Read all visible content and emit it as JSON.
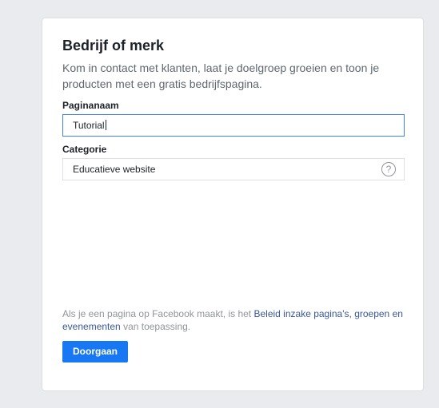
{
  "card": {
    "title": "Bedrijf of merk",
    "description": "Kom in contact met klanten, laat je doelgroep groeien en toon je producten met een gratis bedrijfspagina."
  },
  "form": {
    "page_name_label": "Paginanaam",
    "page_name_value": "Tutorial",
    "category_label": "Categorie",
    "category_value": "Educatieve website",
    "help_icon": "?"
  },
  "policy": {
    "text_before": "Als je een pagina op Facebook maakt, is het ",
    "link1": "Beleid inzake pagina's, groepen en evenementen",
    "text_after": " van toepassing."
  },
  "actions": {
    "continue_label": "Doorgaan"
  },
  "colors": {
    "accent": "#1877f2",
    "link": "#385898",
    "focus_border": "#4080ff"
  }
}
